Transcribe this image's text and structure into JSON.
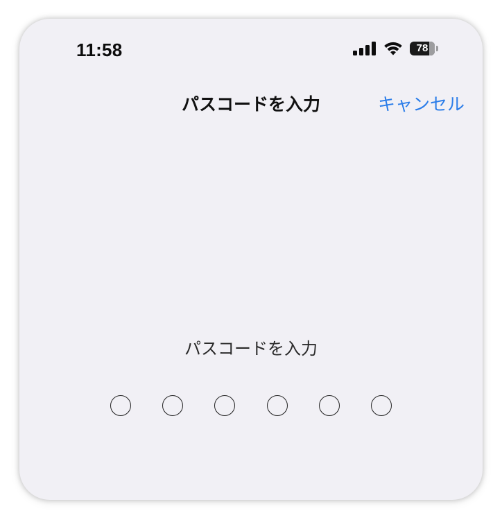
{
  "status_bar": {
    "time": "11:58",
    "battery_level": "78",
    "battery_fraction": 0.78,
    "icons": [
      "cellular-signal-icon",
      "wifi-icon",
      "battery-icon"
    ]
  },
  "nav": {
    "title": "パスコードを入力",
    "cancel_label": "キャンセル"
  },
  "passcode": {
    "prompt": "パスコードを入力",
    "digit_count": 6,
    "entered_count": 0
  },
  "colors": {
    "background": "#f1f0f5",
    "accent": "#2b7de9",
    "text": "#111111"
  }
}
